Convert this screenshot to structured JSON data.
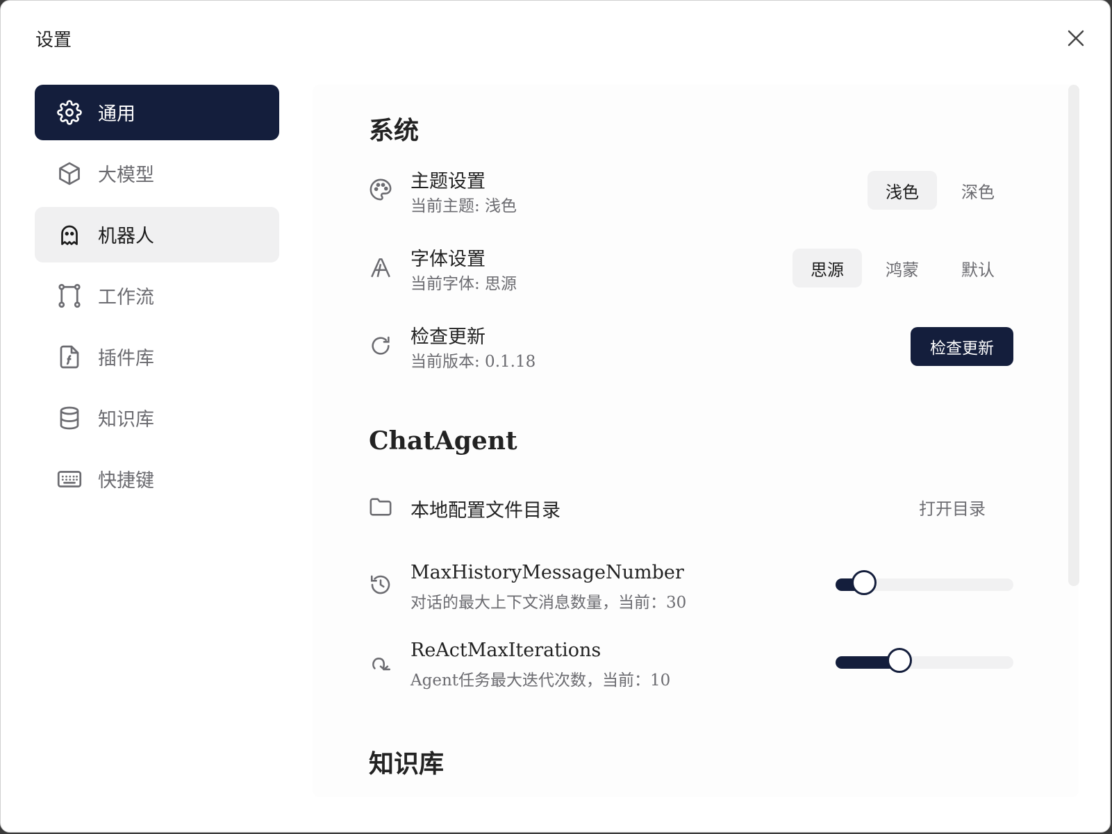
{
  "window": {
    "title": "设置",
    "close_icon": "close-icon"
  },
  "sidebar": {
    "items": [
      {
        "label": "通用",
        "icon": "gear-icon",
        "state": "active"
      },
      {
        "label": "大模型",
        "icon": "cube-icon",
        "state": "normal"
      },
      {
        "label": "机器人",
        "icon": "ghost-icon",
        "state": "hover"
      },
      {
        "label": "工作流",
        "icon": "workflow-icon",
        "state": "normal"
      },
      {
        "label": "插件库",
        "icon": "plugin-file-icon",
        "state": "normal"
      },
      {
        "label": "知识库",
        "icon": "database-icon",
        "state": "normal"
      },
      {
        "label": "快捷键",
        "icon": "keyboard-icon",
        "state": "normal"
      }
    ]
  },
  "sections": {
    "system": {
      "title": "系统",
      "theme": {
        "title": "主题设置",
        "subtitle": "当前主题: 浅色",
        "options": [
          "浅色",
          "深色"
        ],
        "selected": "浅色"
      },
      "font": {
        "title": "字体设置",
        "subtitle": "当前字体: 思源",
        "options": [
          "思源",
          "鸿蒙",
          "默认"
        ],
        "selected": "思源"
      },
      "update": {
        "title": "检查更新",
        "subtitle": "当前版本: 0.1.18",
        "button": "检查更新"
      }
    },
    "chatagent": {
      "title": "ChatAgent",
      "config_dir": {
        "title": "本地配置文件目录",
        "button": "打开目录"
      },
      "max_history": {
        "title": "MaxHistoryMessageNumber",
        "subtitle": "对话的最大上下文消息数量，当前：30",
        "fill_fraction": 0.16
      },
      "react_max": {
        "title": "ReActMaxIterations",
        "subtitle": "Agent任务最大迭代次数，当前：10",
        "fill_fraction": 0.36
      }
    },
    "knowledge": {
      "title": "知识库"
    }
  },
  "colors": {
    "accent": "#141e3c",
    "muted": "#6b6b70",
    "selected_bg": "#f1f1f2"
  }
}
